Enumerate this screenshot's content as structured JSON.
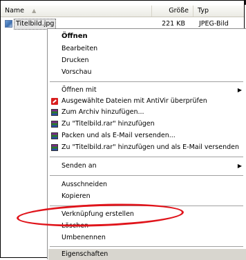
{
  "columns": {
    "name": "Name",
    "size": "Größe",
    "type": "Typ"
  },
  "file": {
    "name": "Titelbild.jpg",
    "size": "221 KB",
    "type": "JPEG-Bild",
    "icon": "image-file-icon"
  },
  "menu": {
    "open": "Öffnen",
    "edit": "Bearbeiten",
    "print": "Drucken",
    "preview": "Vorschau",
    "open_with": "Öffnen mit",
    "antivir": "Ausgewählte Dateien mit AntiVir überprüfen",
    "add_archive": "Zum Archiv hinzufügen...",
    "add_rar": "Zu \"Titelbild.rar\" hinzufügen",
    "pack_email": "Packen und als E-Mail versenden...",
    "rar_email": "Zu \"Titelbild.rar\" hinzufügen und als E-Mail versenden",
    "send_to": "Senden an",
    "cut": "Ausschneiden",
    "copy": "Kopieren",
    "create_shortcut": "Verknüpfung erstellen",
    "delete": "Löschen",
    "rename": "Umbenennen",
    "properties": "Eigenschaften"
  },
  "colors": {
    "annotation": "#e0141b",
    "highlight": "#d8d6cf"
  }
}
